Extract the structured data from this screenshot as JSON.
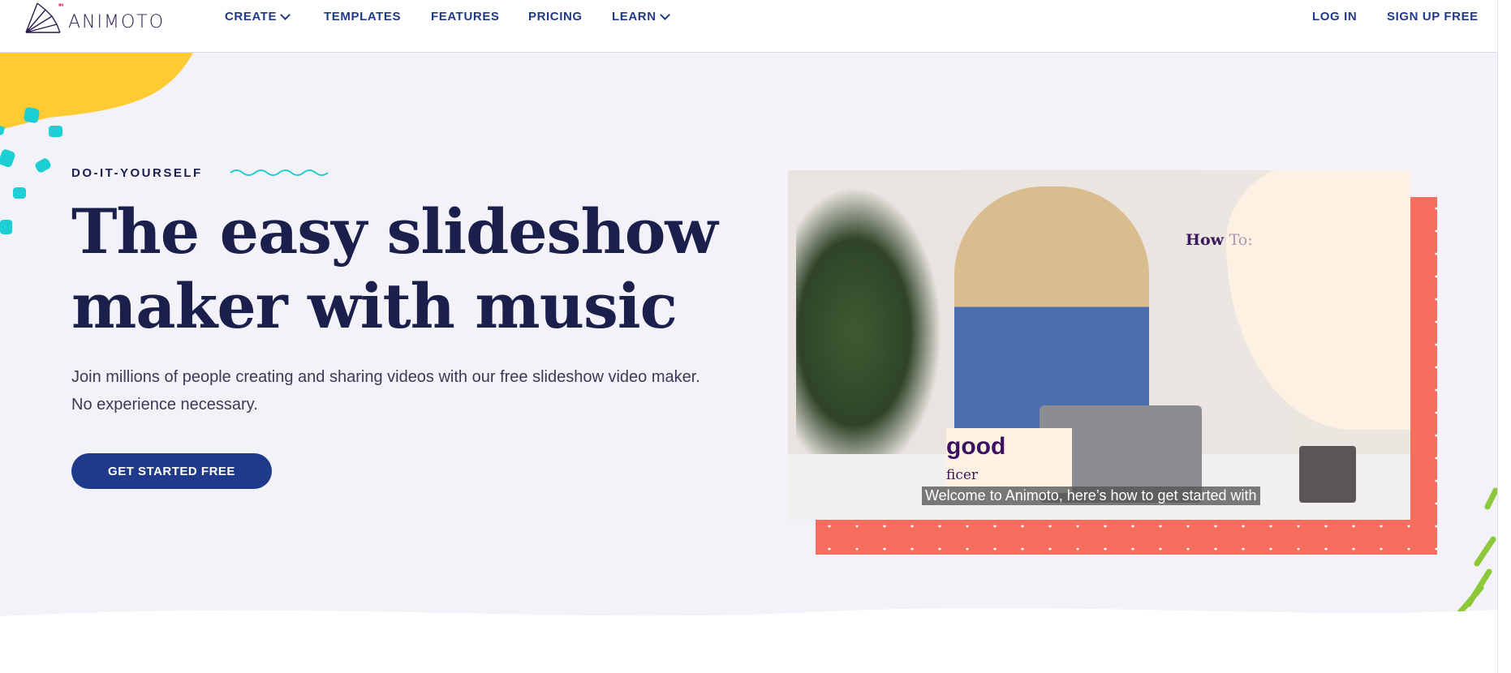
{
  "nav": {
    "logo_text": "ANIMOTO",
    "items": [
      {
        "label": "CREATE",
        "has_dropdown": true
      },
      {
        "label": "TEMPLATES"
      },
      {
        "label": "FEATURES"
      },
      {
        "label": "PRICING"
      },
      {
        "label": "LEARN",
        "has_dropdown": true
      }
    ],
    "login": "LOG IN",
    "signup": "SIGN UP FREE"
  },
  "hero": {
    "eyebrow": "DO-IT-YOURSELF",
    "title_line1": "The easy slideshow",
    "title_line2": "maker with music",
    "lead": "Join millions of people creating and sharing videos with our free slideshow video maker. No experience necessary.",
    "cta": "GET STARTED FREE"
  },
  "video": {
    "howto_a": "How",
    "howto_b": "To:",
    "lower_third_name": "good",
    "lower_third_title": "ficer",
    "caption": "Welcome to Animoto, here’s how to get started with"
  },
  "colors": {
    "brand": "#1f3a8a",
    "heading": "#1b1f4b",
    "hero_bg": "#f3f2f8",
    "accent_coral": "#f76d5e",
    "accent_yellow": "#ffcb33",
    "accent_teal": "#1ccfd2",
    "accent_green": "#8cc83a"
  }
}
